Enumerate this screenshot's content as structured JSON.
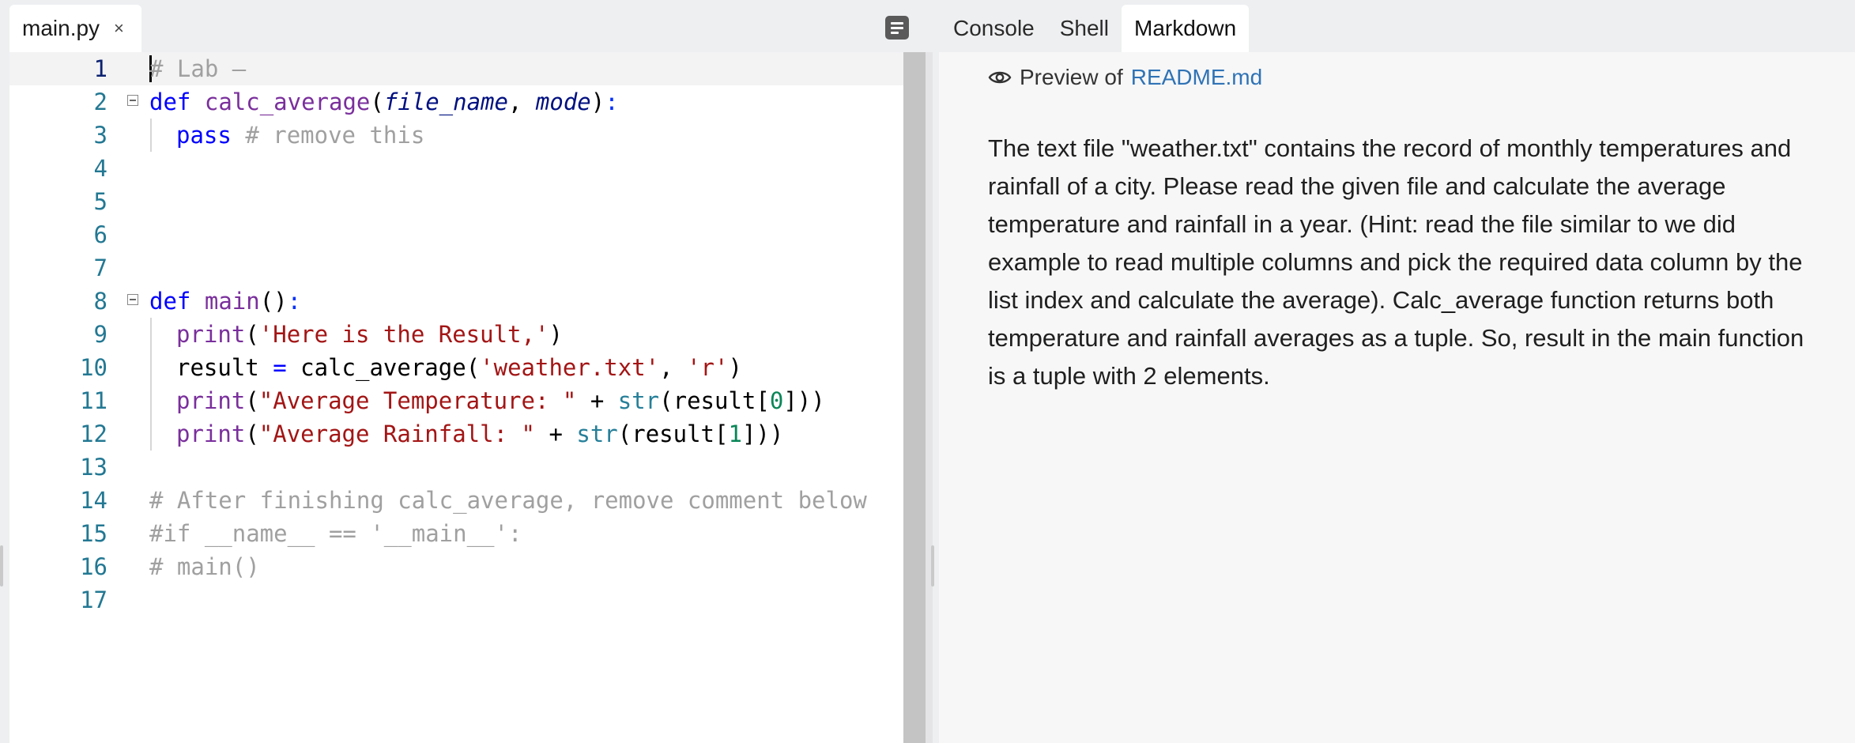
{
  "editor": {
    "file_tab": {
      "name": "main.py",
      "close": "×"
    },
    "lines": [
      {
        "n": "1"
      },
      {
        "n": "2"
      },
      {
        "n": "3"
      },
      {
        "n": "4"
      },
      {
        "n": "5"
      },
      {
        "n": "6"
      },
      {
        "n": "7"
      },
      {
        "n": "8"
      },
      {
        "n": "9"
      },
      {
        "n": "10"
      },
      {
        "n": "11"
      },
      {
        "n": "12"
      },
      {
        "n": "13"
      },
      {
        "n": "14"
      },
      {
        "n": "15"
      },
      {
        "n": "16"
      },
      {
        "n": "17"
      }
    ],
    "code": {
      "l1": "# Lab –",
      "l2_def": "def",
      "l2_name": "calc_average",
      "l2_p1": "file_name",
      "l2_p2": "mode",
      "l3_kw": "pass",
      "l3_cm": "# remove this",
      "l8_def": "def",
      "l8_name": "main",
      "l9_fn": "print",
      "l9_str": "'Here is the Result,'",
      "l10_var": "result",
      "l10_fn": "calc_average",
      "l10_s1": "'weather.txt'",
      "l10_s2": "'r'",
      "l11_fn": "print",
      "l11_str": "\"Average Temperature: \"",
      "l11_bi": "str",
      "l11_arg": "result",
      "l11_idx": "0",
      "l12_fn": "print",
      "l12_str": "\"Average Rainfall: \"",
      "l12_bi": "str",
      "l12_arg": "result",
      "l12_idx": "1",
      "l14": "# After finishing calc_average, remove comment below",
      "l15": "#if __name__ == '__main__':",
      "l16": "# main()"
    }
  },
  "right_panel": {
    "tabs": [
      "Console",
      "Shell",
      "Markdown"
    ],
    "active_tab": "Markdown",
    "preview_label": "Preview of",
    "preview_file": "README.md",
    "body": "The text file \"weather.txt\" contains the record of monthly temperatures and rainfall of a city. Please read the given file and calculate the average temperature and rainfall in a year. (Hint: read the file similar to we did example to read multiple columns and pick the required data column by the list index and calculate the average). Calc_average function returns both temperature and rainfall averages as a tuple. So, result in the main function is a tuple with 2 elements."
  },
  "colors": {
    "accent_link": "#2f73b5",
    "line_number": "#237893",
    "keyword": "#0000ff",
    "string": "#a31515"
  },
  "icons": [
    "close-icon",
    "menu-icon",
    "eye-icon",
    "fold-icon"
  ]
}
